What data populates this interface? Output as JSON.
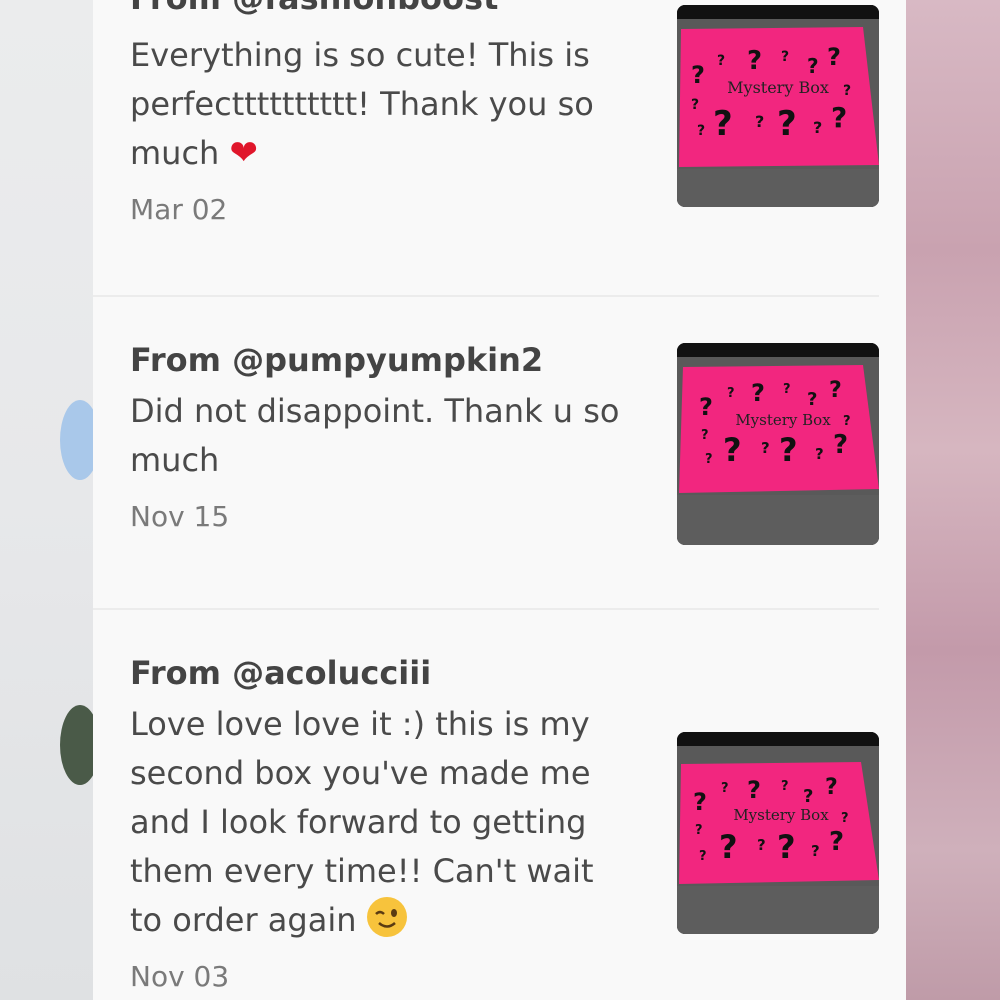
{
  "reviews": [
    {
      "from": "From @fashionboost",
      "text": "Everything is so cute! This is perfectttttttttt! Thank you so much",
      "date": "Mar 02",
      "emoji": "heart-icon",
      "thumb_label": "Mystery Box"
    },
    {
      "from": "From @pumpyumpkin2",
      "text": "Did not disappoint. Thank u so much",
      "date": "Nov 15",
      "thumb_label": "Mystery Box"
    },
    {
      "from": "From @acolucciii",
      "text": "Love love love it :) this is my second box you've made me and I look forward to getting them every time!! Can't wait to order again",
      "date": "Nov 03",
      "emoji": "wink-emoji-icon",
      "thumb_label": "Mystery Box"
    }
  ],
  "colors": {
    "box_pink": "#f2267f",
    "heart": "#e0162b",
    "panel": "#f9f9f9"
  }
}
